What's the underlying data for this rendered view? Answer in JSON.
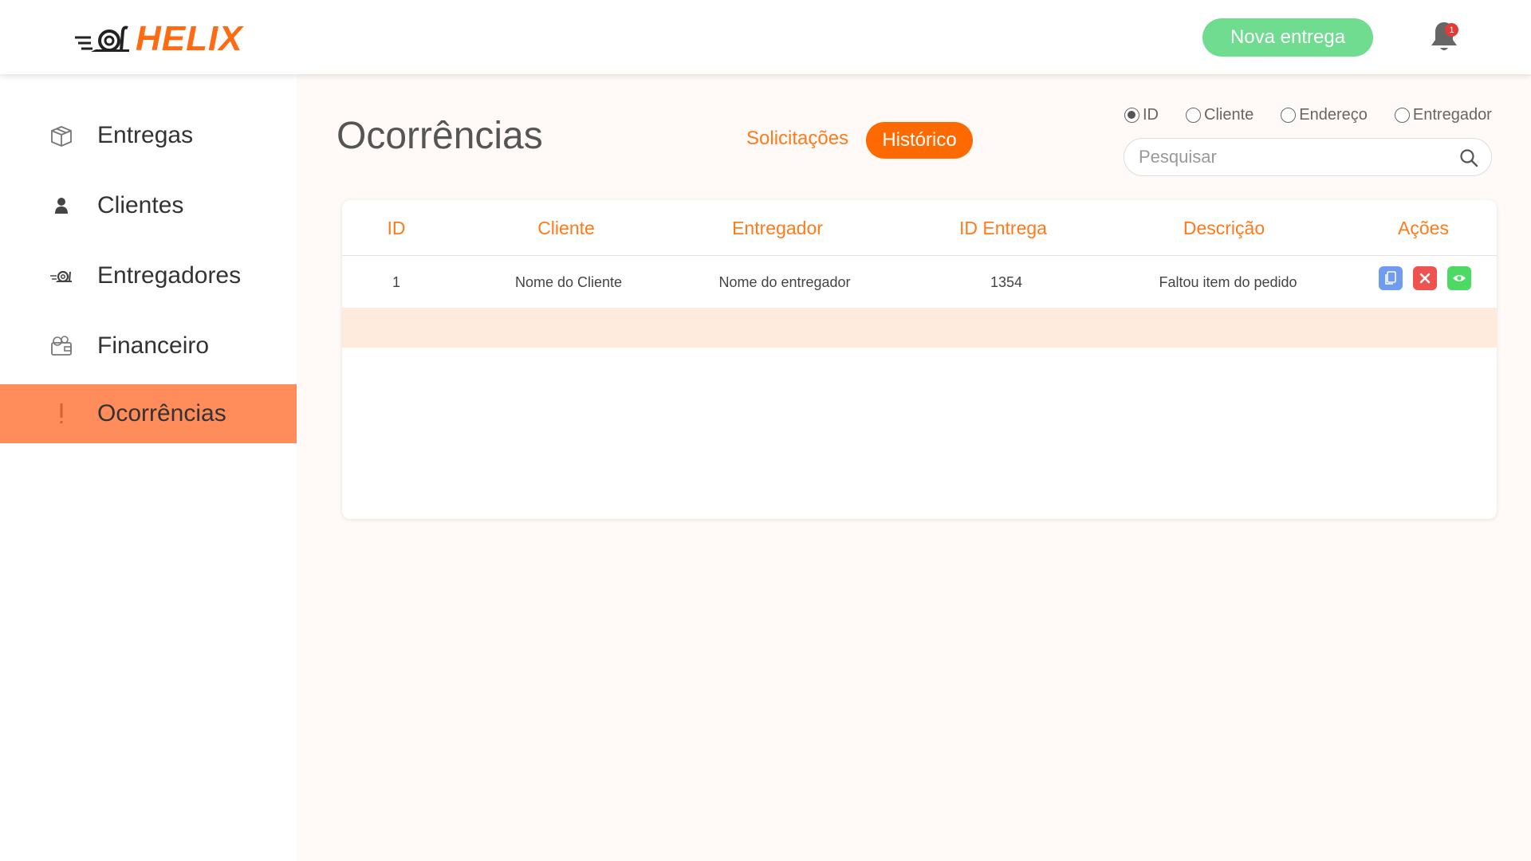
{
  "header": {
    "logo_text": "HELIX",
    "new_delivery_label": "Nova entrega",
    "notification_count": "1"
  },
  "sidebar": {
    "items": [
      {
        "label": "Entregas",
        "icon": "package-icon"
      },
      {
        "label": "Clientes",
        "icon": "person-icon"
      },
      {
        "label": "Entregadores",
        "icon": "snail-icon"
      },
      {
        "label": "Financeiro",
        "icon": "wallet-icon"
      },
      {
        "label": "Ocorrências",
        "icon": "exclamation-icon",
        "active": true
      }
    ]
  },
  "main": {
    "title": "Ocorrências",
    "tabs": {
      "requests": "Solicitações",
      "history": "Histórico"
    },
    "filter": {
      "options": [
        "ID",
        "Cliente",
        "Endereço",
        "Entregador"
      ],
      "selected": "ID"
    },
    "search": {
      "placeholder": "Pesquisar",
      "value": ""
    },
    "table": {
      "columns": [
        "ID",
        "Cliente",
        "Entregador",
        "ID Entrega",
        "Descrição",
        "Ações"
      ],
      "rows": [
        {
          "id": "1",
          "client": "Nome do Cliente",
          "courier": "Nome do entregador",
          "delivery_id": "1354",
          "description": "Faltou item do pedido"
        }
      ]
    }
  },
  "colors": {
    "accent": "#ff6a00",
    "active_nav": "#ff8c5a",
    "new_button": "#6fdc90",
    "copy_action": "#6f9cf0",
    "delete_action": "#ef5350",
    "view_action": "#4cd964"
  }
}
